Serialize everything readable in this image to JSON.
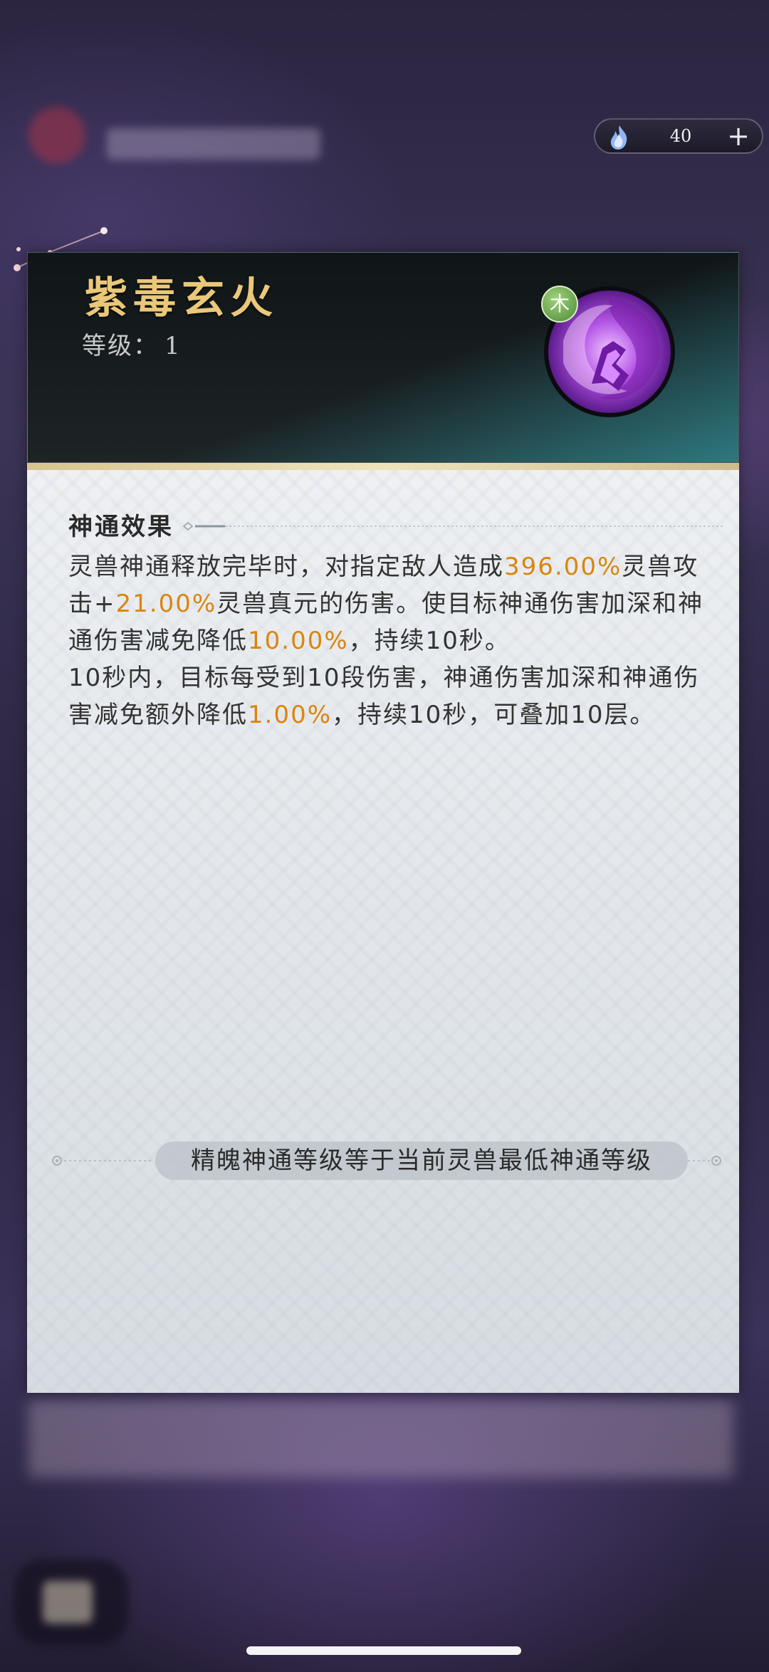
{
  "currency": {
    "icon": "spirit-flame-icon",
    "value": "40",
    "add_symbol": "+"
  },
  "skill": {
    "name": "紫毒玄火",
    "level_label": "等级：",
    "level_value": "1",
    "element_badge": "木",
    "icon": "purple-vortex-skill-icon"
  },
  "effect": {
    "section_title": "神通效果",
    "segments": [
      {
        "text": "灵兽神通释放完毕时，对指定敌人造成",
        "highlight": false
      },
      {
        "text": "396.00%",
        "highlight": true
      },
      {
        "text": "灵兽攻击+",
        "highlight": false
      },
      {
        "text": "21.00%",
        "highlight": true
      },
      {
        "text": "灵兽真元的伤害。使目标神通伤害加深和神通伤害减免降低",
        "highlight": false
      },
      {
        "text": "10.00%",
        "highlight": true
      },
      {
        "text": "，持续10秒。",
        "highlight": false
      },
      {
        "text": "\n",
        "highlight": false
      },
      {
        "text": "10秒内，目标每受到10段伤害，神通伤害加深和神通伤害减免额外降低",
        "highlight": false
      },
      {
        "text": "1.00%",
        "highlight": true
      },
      {
        "text": "，持续10秒，可叠加10层。",
        "highlight": false
      }
    ]
  },
  "note": "精魄神通等级等于当前灵兽最低神通等级",
  "colors": {
    "gold_title": "#eac879",
    "highlight": "#d9860f",
    "element_green": "#4f8a36"
  }
}
